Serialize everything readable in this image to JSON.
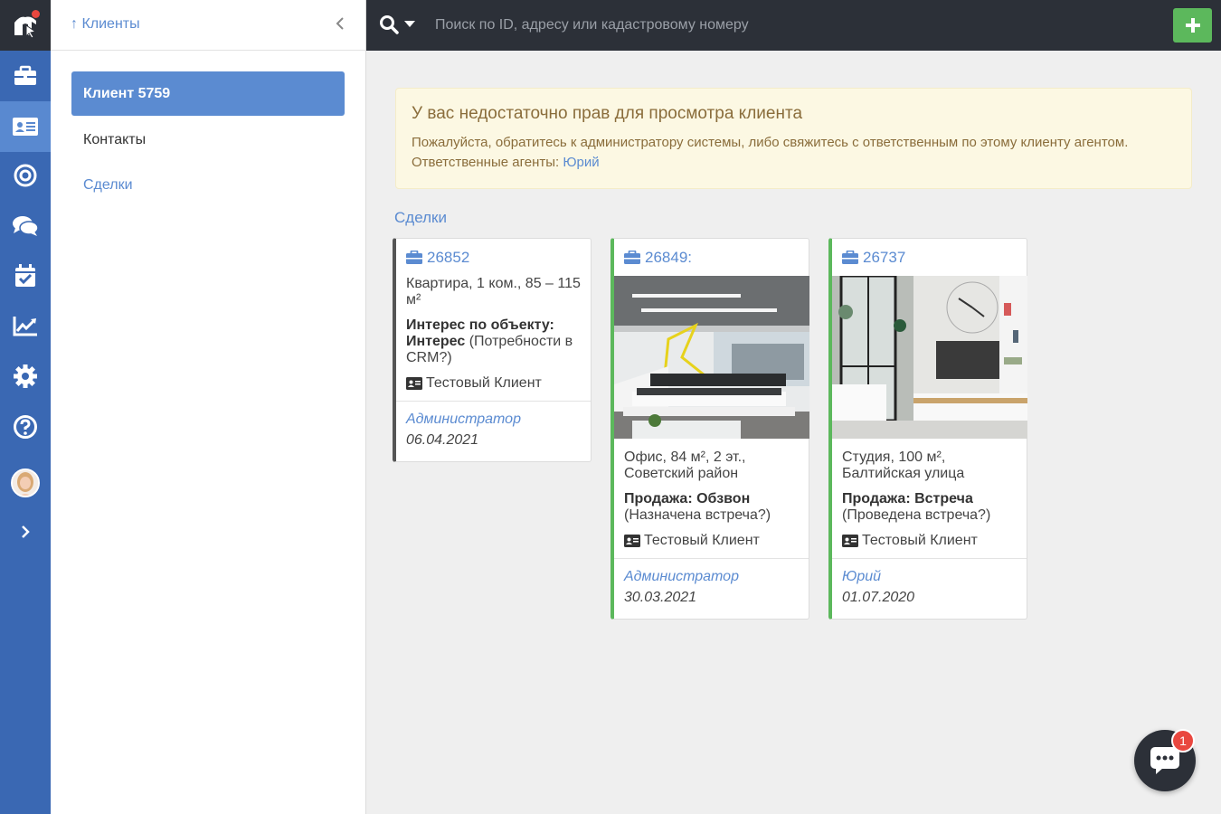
{
  "sidebar": {
    "back_label": "↑ Клиенты",
    "items": [
      {
        "label": "Клиент 5759"
      },
      {
        "label": "Контакты"
      },
      {
        "label": "Сделки"
      }
    ]
  },
  "search": {
    "placeholder": "Поиск по ID, адресу или кадастровому номеру"
  },
  "alert": {
    "title": "У вас недостаточно прав для просмотра клиента",
    "text": "Пожалуйста, обратитесь к администратору системы, либо свяжитесь с ответственным по этому клиенту агентом.",
    "agents_label": "Ответственные агенты:",
    "agent_name": "Юрий"
  },
  "deals": {
    "title": "Сделки",
    "cards": [
      {
        "id": "26852",
        "description": "Квартира, 1 ком., 85 – 115 м²",
        "stage_bold_1": "Интерес по объекту:",
        "stage_bold_2": "Интерес",
        "stage_note": "(Потребности в CRM?)",
        "client": "Тестовый Клиент",
        "agent": "Администратор",
        "date": "06.04.2021"
      },
      {
        "id": "26849:",
        "description": "Офис, 84 м², 2 эт., Советский район",
        "stage_bold": "Продажа: Обзвон",
        "stage_note": "(Назначена встреча?)",
        "client": "Тестовый Клиент",
        "agent": "Администратор",
        "date": "30.03.2021"
      },
      {
        "id": "26737",
        "description": "Студия, 100 м², Балтийская улица",
        "stage_bold": "Продажа: Встреча",
        "stage_note": "(Проведена встреча?)",
        "client": "Тестовый Клиент",
        "agent": "Юрий",
        "date": "01.07.2020"
      }
    ]
  },
  "chat": {
    "badge_count": "1"
  },
  "colors": {
    "rail": "#3a68b3",
    "topbar": "#2c3038",
    "accent": "#5b8bd1",
    "success": "#5cb85c",
    "warning_bg": "#fcf8e3"
  }
}
